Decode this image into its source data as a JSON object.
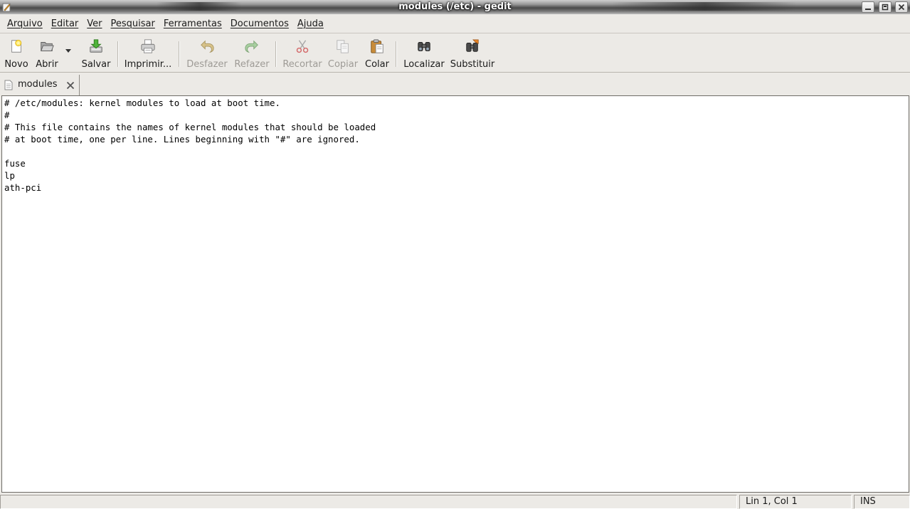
{
  "window": {
    "title": "modules (/etc) - gedit",
    "controls": [
      "minimize",
      "maximize",
      "close"
    ]
  },
  "menubar": {
    "items": [
      {
        "label": "Arquivo"
      },
      {
        "label": "Editar"
      },
      {
        "label": "Ver"
      },
      {
        "label": "Pesquisar"
      },
      {
        "label": "Ferramentas"
      },
      {
        "label": "Documentos"
      },
      {
        "label": "Ajuda"
      }
    ]
  },
  "toolbar": {
    "new_label": "Novo",
    "open_label": "Abrir",
    "save_label": "Salvar",
    "print_label": "Imprimir...",
    "undo_label": "Desfazer",
    "redo_label": "Refazer",
    "cut_label": "Recortar",
    "copy_label": "Copiar",
    "paste_label": "Colar",
    "find_label": "Localizar",
    "replace_label": "Substituir"
  },
  "tabs": [
    {
      "label": "modules",
      "active": true
    }
  ],
  "editor": {
    "lines": [
      "# /etc/modules: kernel modules to load at boot time.",
      "#",
      "# This file contains the names of kernel modules that should be loaded",
      "# at boot time, one per line. Lines beginning with \"#\" are ignored.",
      "",
      "fuse",
      "lp",
      "ath-pci"
    ]
  },
  "statusbar": {
    "position": "Lin 1, Col 1",
    "mode": "INS"
  },
  "colors": {
    "window_bg": "#eceae6",
    "editor_bg": "#ffffff",
    "disabled_text": "#9e9b96"
  }
}
